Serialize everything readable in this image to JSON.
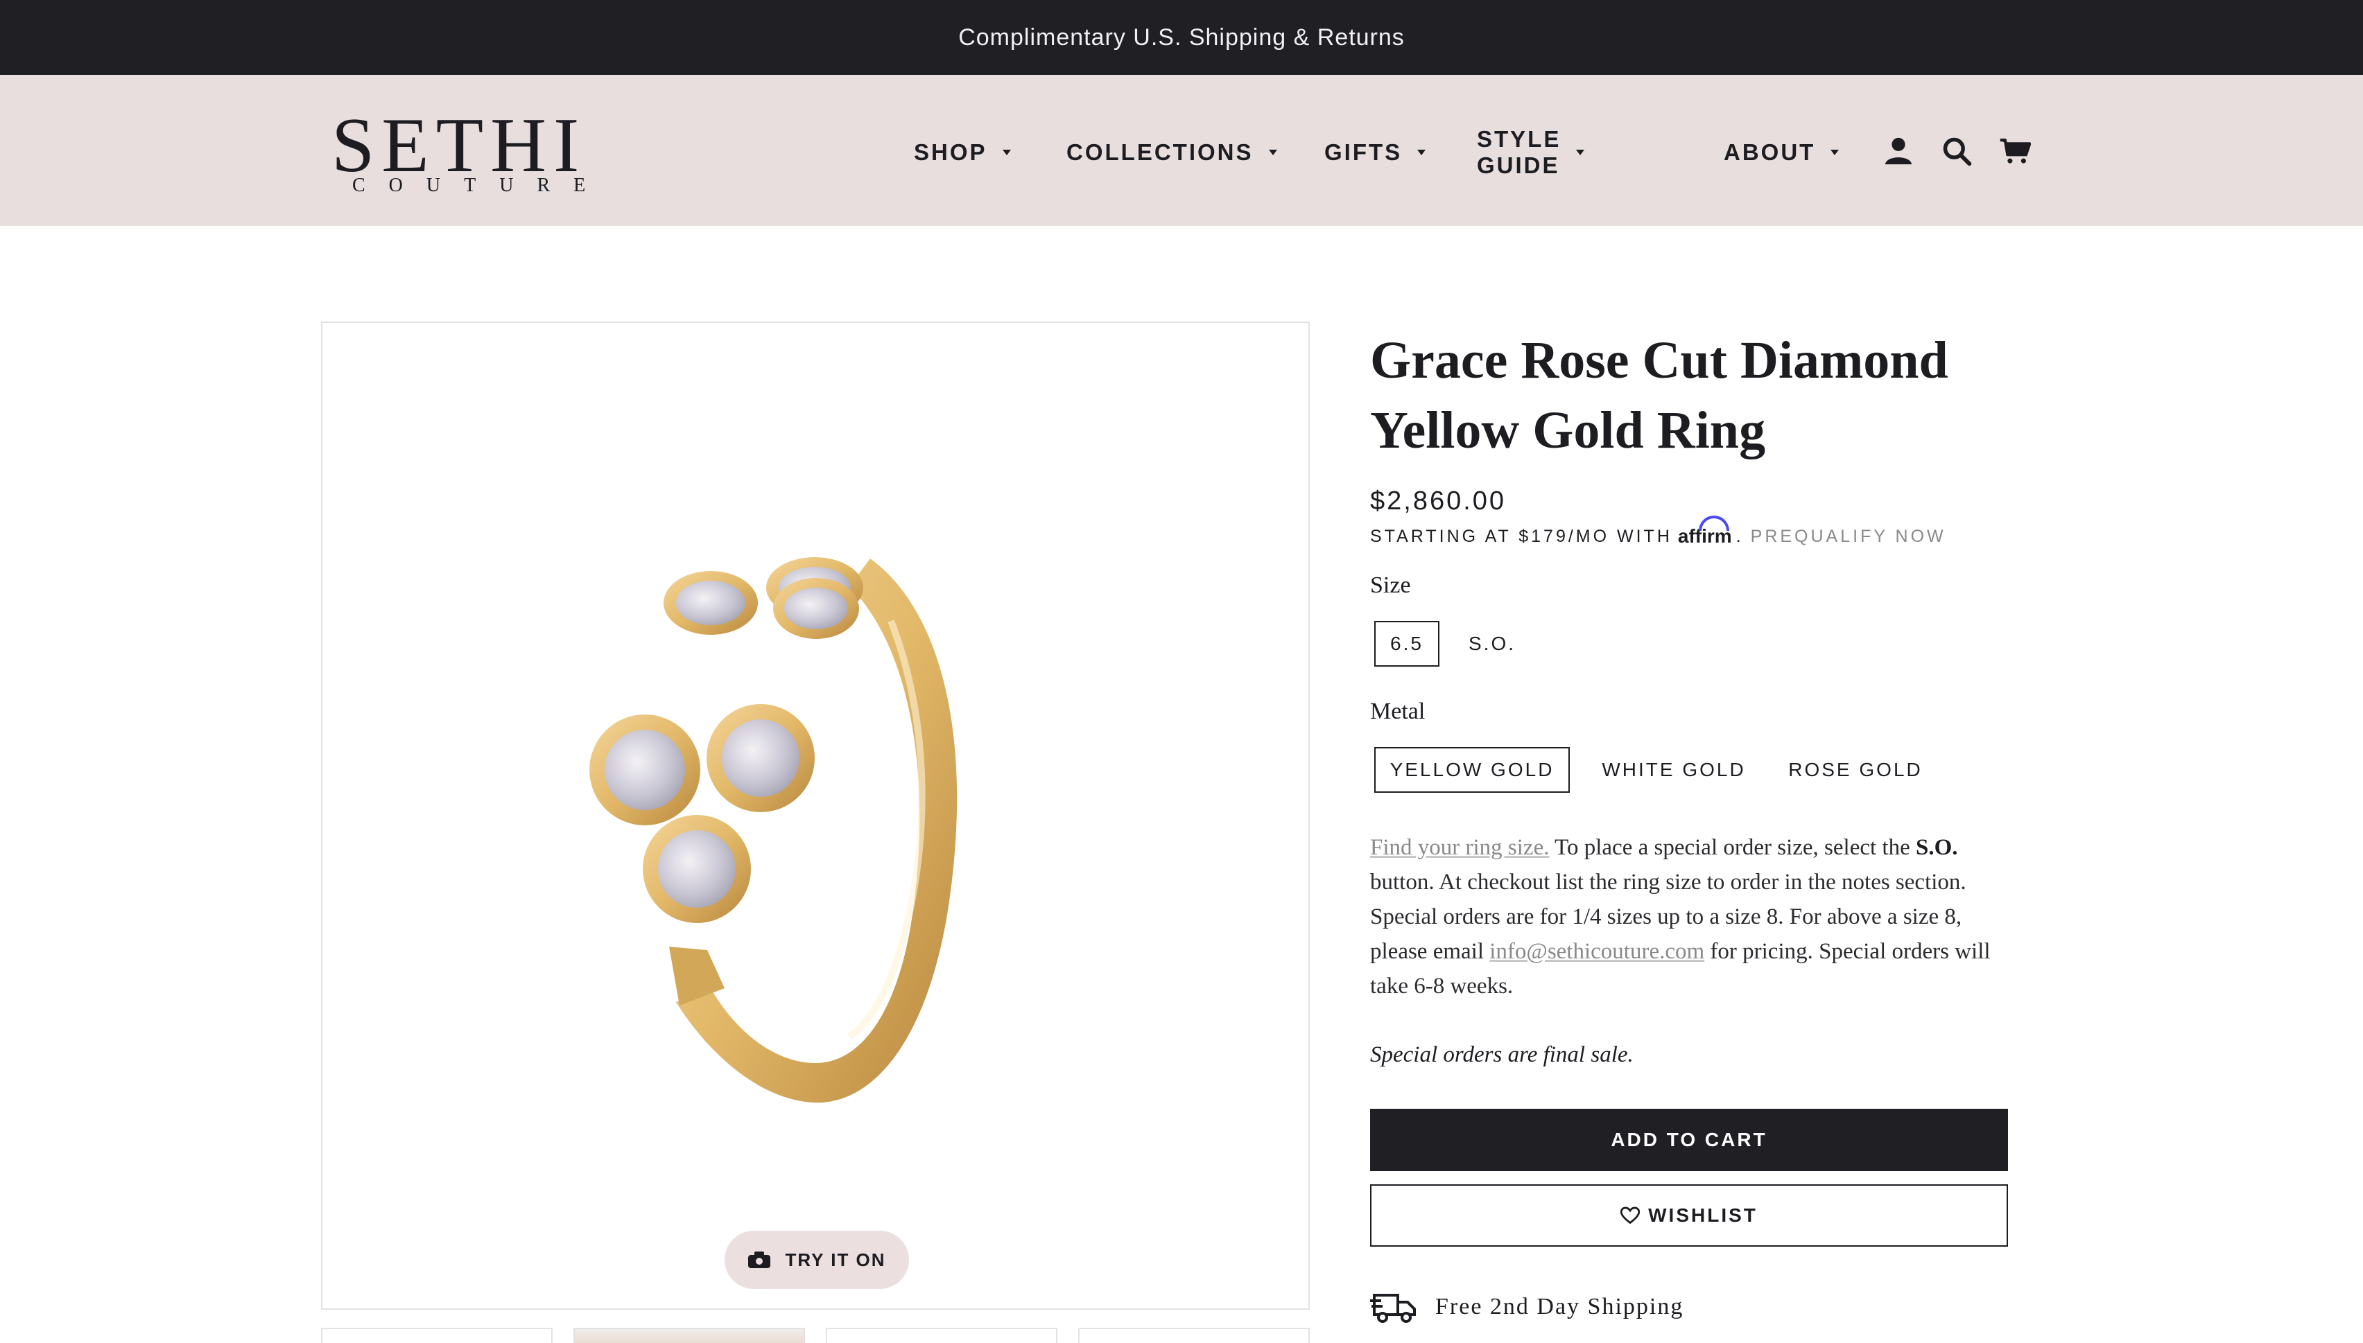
{
  "announcement": {
    "text": "Complimentary U.S. Shipping & Returns"
  },
  "header": {
    "logo": {
      "main": "SETHI",
      "sub": "COUTURE"
    },
    "nav": [
      {
        "label": "SHOP",
        "has_dropdown": true
      },
      {
        "label": "COLLECTIONS",
        "has_dropdown": true
      },
      {
        "label": "GIFTS",
        "has_dropdown": true
      },
      {
        "label": "STYLE GUIDE",
        "has_dropdown": true
      },
      {
        "label": "ABOUT",
        "has_dropdown": true
      }
    ],
    "icons": [
      "account-icon",
      "search-icon",
      "cart-icon"
    ]
  },
  "gallery": {
    "try_on_label": "TRY IT ON",
    "try_on_icon": "camera-icon"
  },
  "product": {
    "title_line1": "Grace Rose Cut Diamond",
    "title_line2": "Yellow Gold Ring",
    "price": "$2,860.00",
    "financing": {
      "prefix": "STARTING AT $179/MO WITH",
      "brand": "affirm",
      "suffix": ".",
      "cta": "PREQUALIFY NOW"
    },
    "size": {
      "label": "Size",
      "options": [
        "6.5",
        "S.O."
      ],
      "selected": "6.5"
    },
    "metal": {
      "label": "Metal",
      "options": [
        "YELLOW GOLD",
        "WHITE GOLD",
        "ROSE GOLD"
      ],
      "selected": "YELLOW GOLD"
    },
    "description": {
      "link_ring_size": "Find your ring size.",
      "part1": " To place a special order size, select the ",
      "so_bold": "S.O.",
      "part2": " button. At checkout list the ring size to order in the notes section. Special orders are for 1/4 sizes up to a size 8. For above a size 8, please email ",
      "email": "info@sethicouture.com",
      "part3": " for pricing. Special orders will take 6-8 weeks."
    },
    "final_sale": "Special orders are final sale.",
    "add_to_cart": "ADD TO CART",
    "wishlist": "WISHLIST",
    "shipping": "Free 2nd Day Shipping"
  },
  "colors": {
    "announcement_bg": "#201f24",
    "header_bg": "#e8dede",
    "text": "#1d1c21",
    "muted": "#8b888c",
    "gold": "#e2b868",
    "affirm_blue": "#4a4af4"
  }
}
